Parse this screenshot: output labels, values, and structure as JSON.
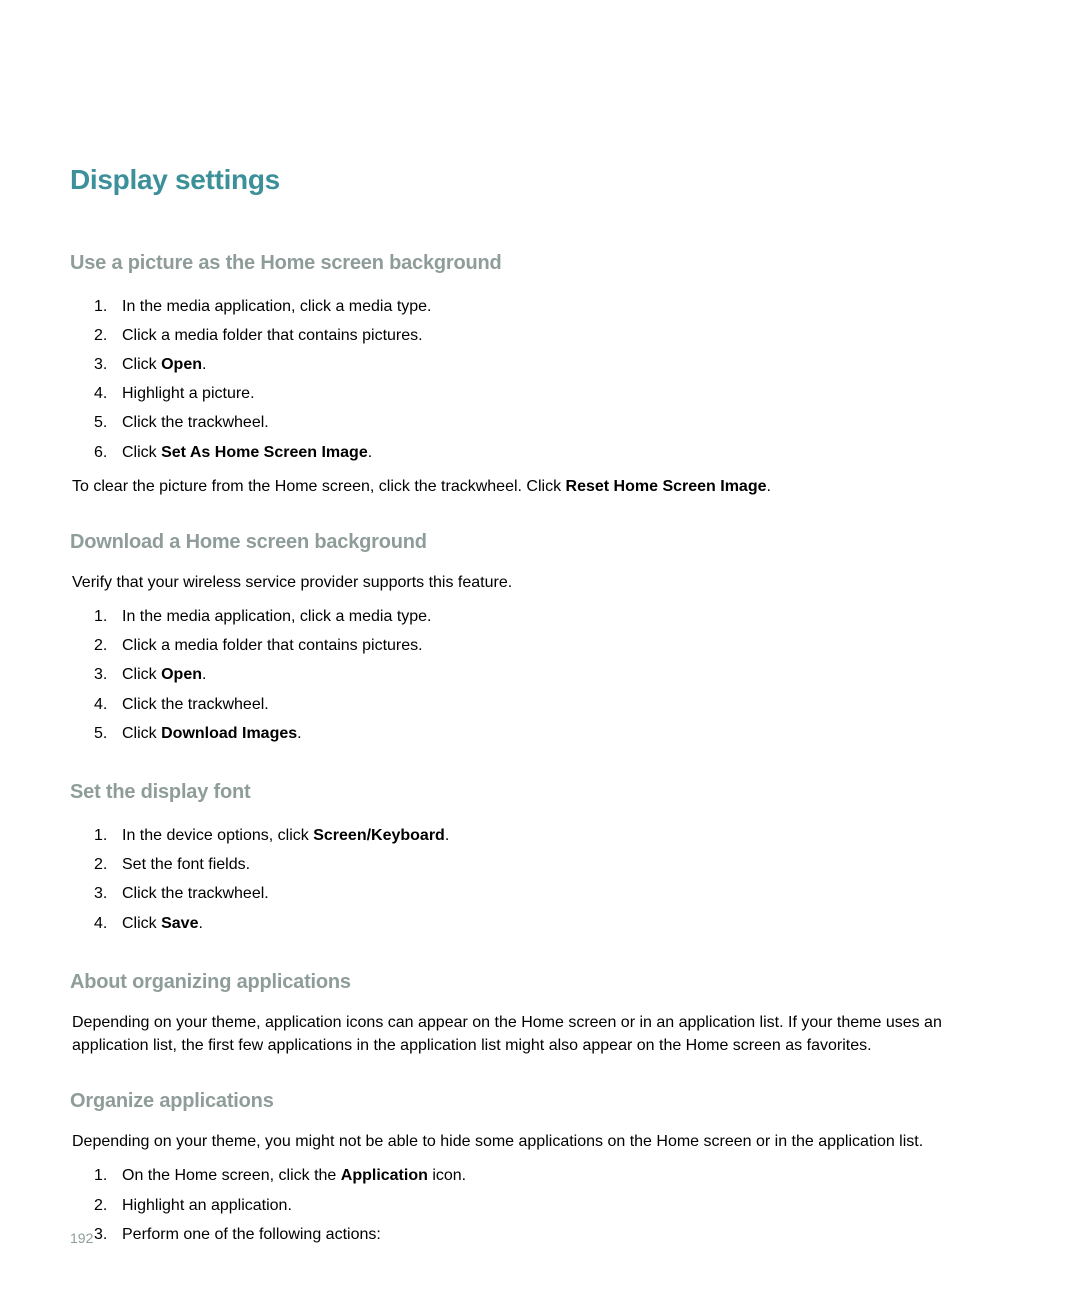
{
  "page": {
    "title": "Display settings",
    "number": "192"
  },
  "sections": [
    {
      "heading": "Use a picture as the Home screen background",
      "steps": [
        {
          "n": "1.",
          "plain": "In the media application, click a media type."
        },
        {
          "n": "2.",
          "plain": "Click a media folder that contains pictures."
        },
        {
          "n": "3.",
          "pre": "Click ",
          "bold": "Open",
          "post": "."
        },
        {
          "n": "4.",
          "plain": "Highlight a picture."
        },
        {
          "n": "5.",
          "plain": "Click the trackwheel."
        },
        {
          "n": "6.",
          "pre": "Click ",
          "bold": "Set As Home Screen Image",
          "post": "."
        }
      ],
      "after": {
        "pre": "To clear the picture from the Home screen, click the trackwheel. Click ",
        "bold": "Reset Home Screen Image",
        "post": "."
      }
    },
    {
      "heading": "Download a Home screen background",
      "intro": "Verify that your wireless service provider supports this feature.",
      "steps": [
        {
          "n": "1.",
          "plain": "In the media application, click a media type."
        },
        {
          "n": "2.",
          "plain": "Click a media folder that contains pictures."
        },
        {
          "n": "3.",
          "pre": "Click ",
          "bold": "Open",
          "post": "."
        },
        {
          "n": "4.",
          "plain": "Click the trackwheel."
        },
        {
          "n": "5.",
          "pre": "Click ",
          "bold": "Download Images",
          "post": "."
        }
      ]
    },
    {
      "heading": "Set the display font",
      "steps": [
        {
          "n": "1.",
          "pre": "In the device options, click ",
          "bold": "Screen/Keyboard",
          "post": "."
        },
        {
          "n": "2.",
          "plain": "Set the font fields."
        },
        {
          "n": "3.",
          "plain": "Click the trackwheel."
        },
        {
          "n": "4.",
          "pre": "Click ",
          "bold": "Save",
          "post": "."
        }
      ]
    },
    {
      "heading": "About organizing applications",
      "body": "Depending on your theme, application icons can appear on the Home screen or in an application list. If your theme uses an application list, the first few applications in the application list might also appear on the Home screen as favorites."
    },
    {
      "heading": "Organize applications",
      "intro": "Depending on your theme, you might not be able to hide some applications on the Home screen or in the application list.",
      "steps": [
        {
          "n": "1.",
          "pre": "On the Home screen, click the ",
          "bold": "Application",
          "post": " icon."
        },
        {
          "n": "2.",
          "plain": "Highlight an application."
        },
        {
          "n": "3.",
          "plain": "Perform one of the following actions:"
        }
      ]
    }
  ]
}
